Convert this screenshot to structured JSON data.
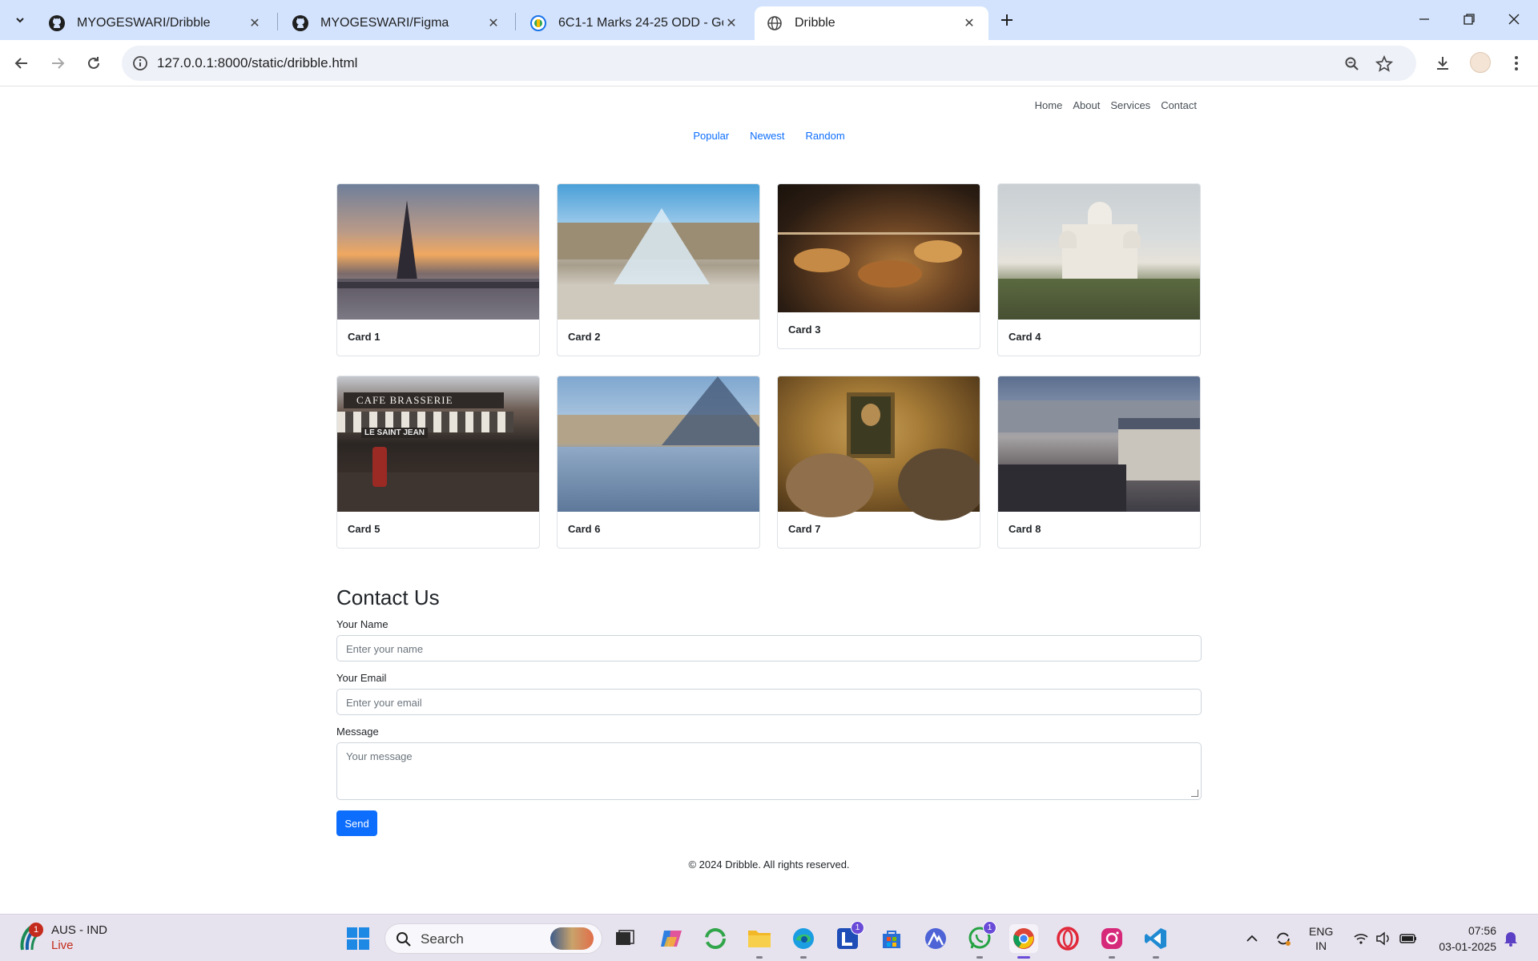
{
  "browser": {
    "tabs": [
      {
        "title": "MYOGESWARI/Dribble",
        "icon": "github-icon"
      },
      {
        "title": "MYOGESWARI/Figma",
        "icon": "github-icon"
      },
      {
        "title": "6C1-1 Marks 24-25 ODD - Goo",
        "icon": "google-sheets-icon"
      },
      {
        "title": "Dribble",
        "icon": "globe-icon"
      }
    ],
    "url": "127.0.0.1:8000/static/dribble.html"
  },
  "site": {
    "nav": [
      "Home",
      "About",
      "Services",
      "Contact"
    ],
    "filters": [
      "Popular",
      "Newest",
      "Random"
    ],
    "cards": [
      "Card 1",
      "Card 2",
      "Card 3",
      "Card 4",
      "Card 5",
      "Card 6",
      "Card 7",
      "Card 8"
    ],
    "photo_text": {
      "cafe_sign": "CAFE   BRASSERIE",
      "awning": "LE SAINT JEAN"
    },
    "contact": {
      "heading": "Contact Us",
      "name_label": "Your Name",
      "name_placeholder": "Enter your name",
      "email_label": "Your Email",
      "email_placeholder": "Enter your email",
      "message_label": "Message",
      "message_placeholder": "Your message",
      "send_label": "Send"
    },
    "footer": "© 2024 Dribble. All rights reserved.",
    "accent_color": "#0d6efd"
  },
  "taskbar": {
    "weather_badge": "1",
    "match_title": "AUS - IND",
    "match_status": "Live",
    "search_placeholder": "Search",
    "badges": {
      "teams": "1",
      "whatsapp": "1"
    },
    "lang_line1": "ENG",
    "lang_line2": "IN",
    "time": "07:56",
    "date": "03-01-2025"
  }
}
